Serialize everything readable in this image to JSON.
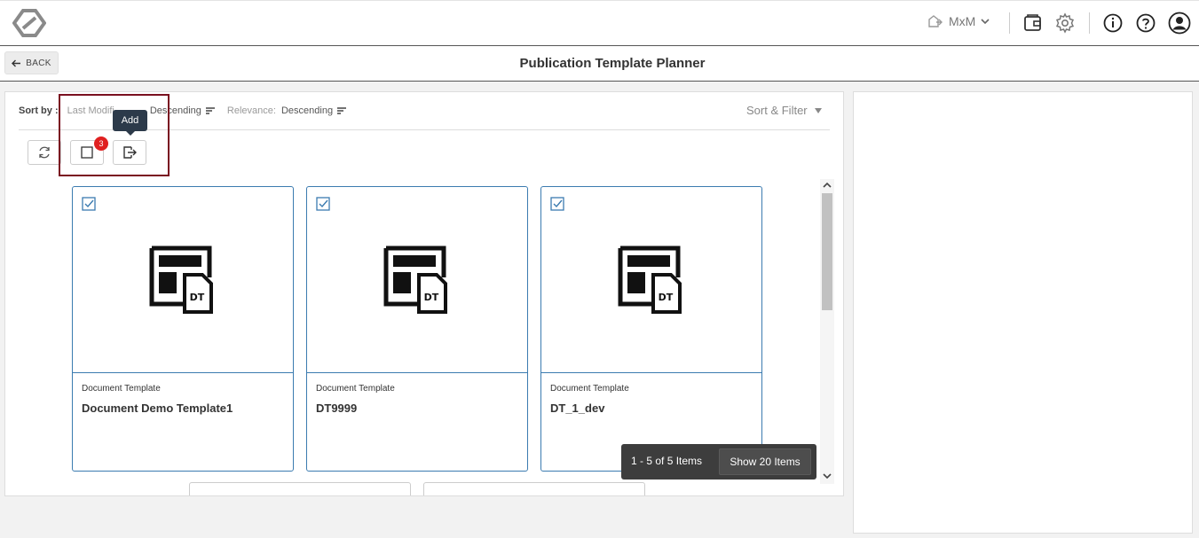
{
  "header": {
    "user_label": "MxM"
  },
  "subheader": {
    "back_label": "BACK",
    "title": "Publication Template Planner"
  },
  "sortbar": {
    "label": "Sort by :",
    "sort1_field": "Last Modifi",
    "sort1_order": "Descending",
    "sort2_field": "Relevance:",
    "sort2_order": "Descending",
    "sort_filter_label": "Sort & Filter"
  },
  "toolbar": {
    "selected_count": "3",
    "tooltip": "Add"
  },
  "cards": [
    {
      "type": "Document Template",
      "name": "Document Demo Template1",
      "thumb_label": "DT"
    },
    {
      "type": "Document Template",
      "name": "DT9999",
      "thumb_label": "DT"
    },
    {
      "type": "Document Template",
      "name": "DT_1_dev",
      "thumb_label": "DT"
    }
  ],
  "pager": {
    "range": "1 - 5 of 5 Items",
    "show_label": "Show 20 Items"
  },
  "colors": {
    "accent": "#3b7bb0",
    "highlight": "#7a1020",
    "badge": "#e02020"
  }
}
